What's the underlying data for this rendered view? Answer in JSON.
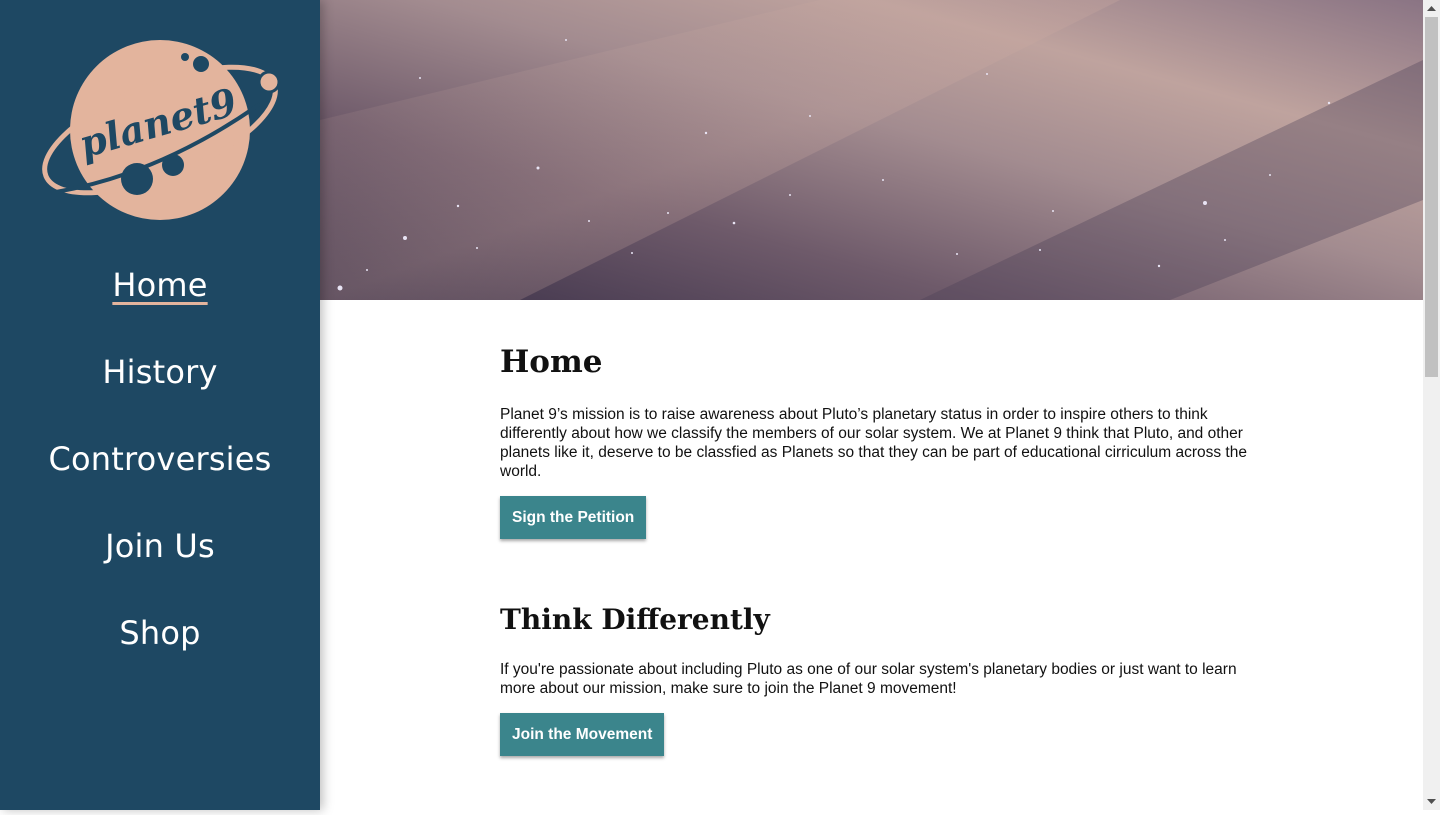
{
  "brand": {
    "logo_text": "planet9",
    "colors": {
      "sidebar": "#1e4863",
      "logo": "#e3b49d",
      "button": "#3b858c"
    }
  },
  "nav": {
    "items": [
      {
        "label": "Home",
        "active": true
      },
      {
        "label": "History",
        "active": false
      },
      {
        "label": "Controversies",
        "active": false
      },
      {
        "label": "Join Us",
        "active": false
      },
      {
        "label": "Shop",
        "active": false
      }
    ]
  },
  "hero": {
    "description": "starry night sky image"
  },
  "sections": [
    {
      "title": "Home",
      "body": "Planet 9’s mission is to raise awareness about Pluto’s planetary status in order to inspire others to think differently about how we classify the members of our solar system. We at Planet 9 think that Pluto, and other planets like it, deserve to be classfied as Planets so that they can be part of educational cirriculum across the world.",
      "button": "Sign the Petition"
    },
    {
      "title": "Think Differently",
      "body": "If you're passionate about including Pluto as one of our solar system's planetary bodies or just want to learn more about our mission, make sure to join the Planet 9 movement!",
      "button": "Join the Movement"
    }
  ]
}
